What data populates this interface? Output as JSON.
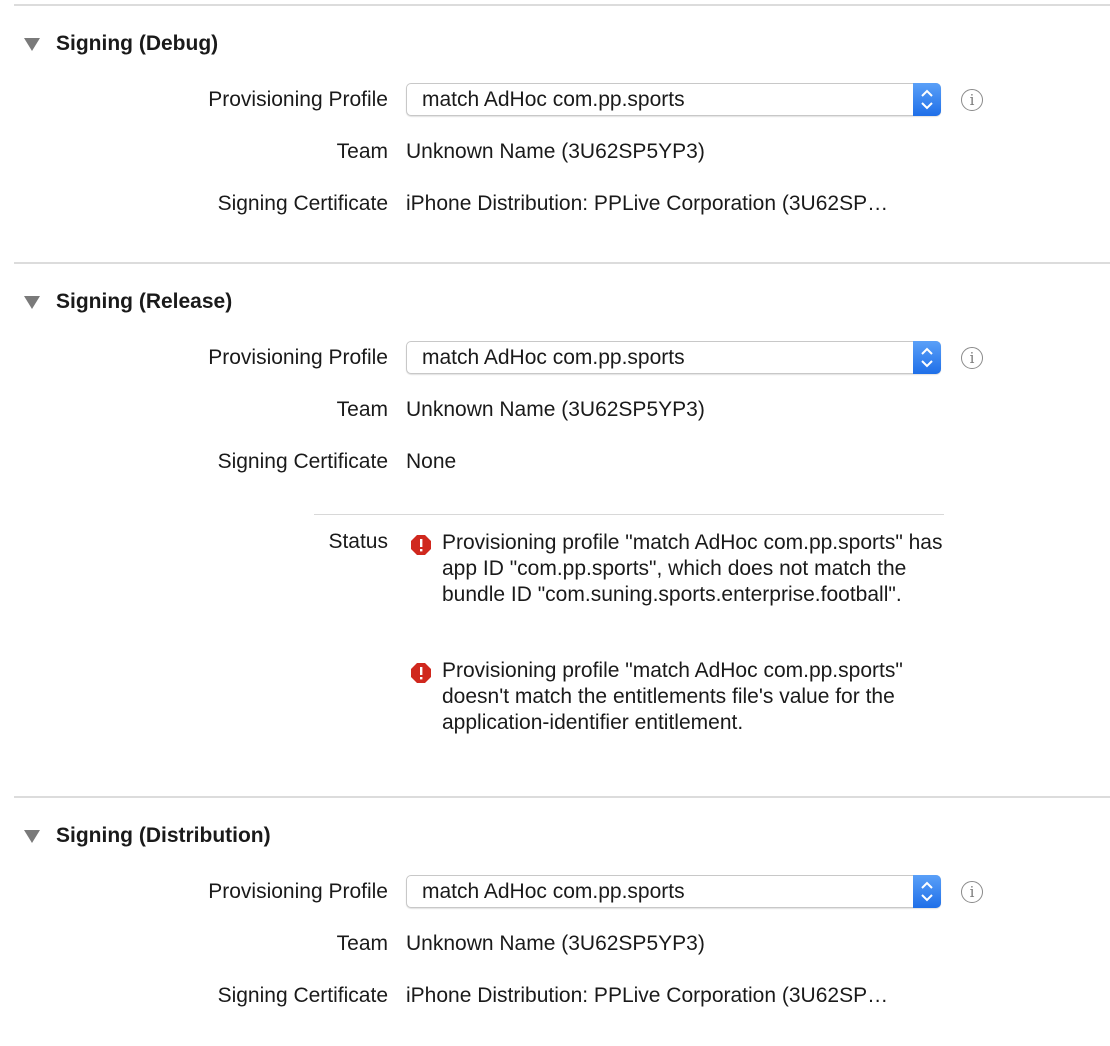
{
  "sections": [
    {
      "title": "Signing (Debug)",
      "provisioning_profile_label": "Provisioning Profile",
      "provisioning_profile_value": "match AdHoc com.pp.sports",
      "team_label": "Team",
      "team_value": "Unknown Name (3U62SP5YP3)",
      "certificate_label": "Signing Certificate",
      "certificate_value": "iPhone Distribution: PPLive Corporation (3U62SP…"
    },
    {
      "title": "Signing (Release)",
      "provisioning_profile_label": "Provisioning Profile",
      "provisioning_profile_value": "match AdHoc com.pp.sports",
      "team_label": "Team",
      "team_value": "Unknown Name (3U62SP5YP3)",
      "certificate_label": "Signing Certificate",
      "certificate_value": "None",
      "status_label": "Status",
      "status_messages": [
        "Provisioning profile \"match AdHoc com.pp.sports\" has app ID \"com.pp.sports\", which does not match the bundle ID \"com.suning.sports.enterprise.football\".",
        "Provisioning profile \"match AdHoc com.pp.sports\" doesn't match the entitlements file's value for the application-identifier entitlement."
      ]
    },
    {
      "title": "Signing (Distribution)",
      "provisioning_profile_label": "Provisioning Profile",
      "provisioning_profile_value": "match AdHoc com.pp.sports",
      "team_label": "Team",
      "team_value": "Unknown Name (3U62SP5YP3)",
      "certificate_label": "Signing Certificate",
      "certificate_value": "iPhone Distribution: PPLive Corporation (3U62SP…"
    }
  ],
  "icons": {
    "disclosure": "disclosure-triangle-icon",
    "info": "info-icon",
    "error": "error-icon"
  },
  "colors": {
    "accent": "#2a7bf0",
    "error": "#d0281e",
    "divider": "#dcdcdc"
  }
}
